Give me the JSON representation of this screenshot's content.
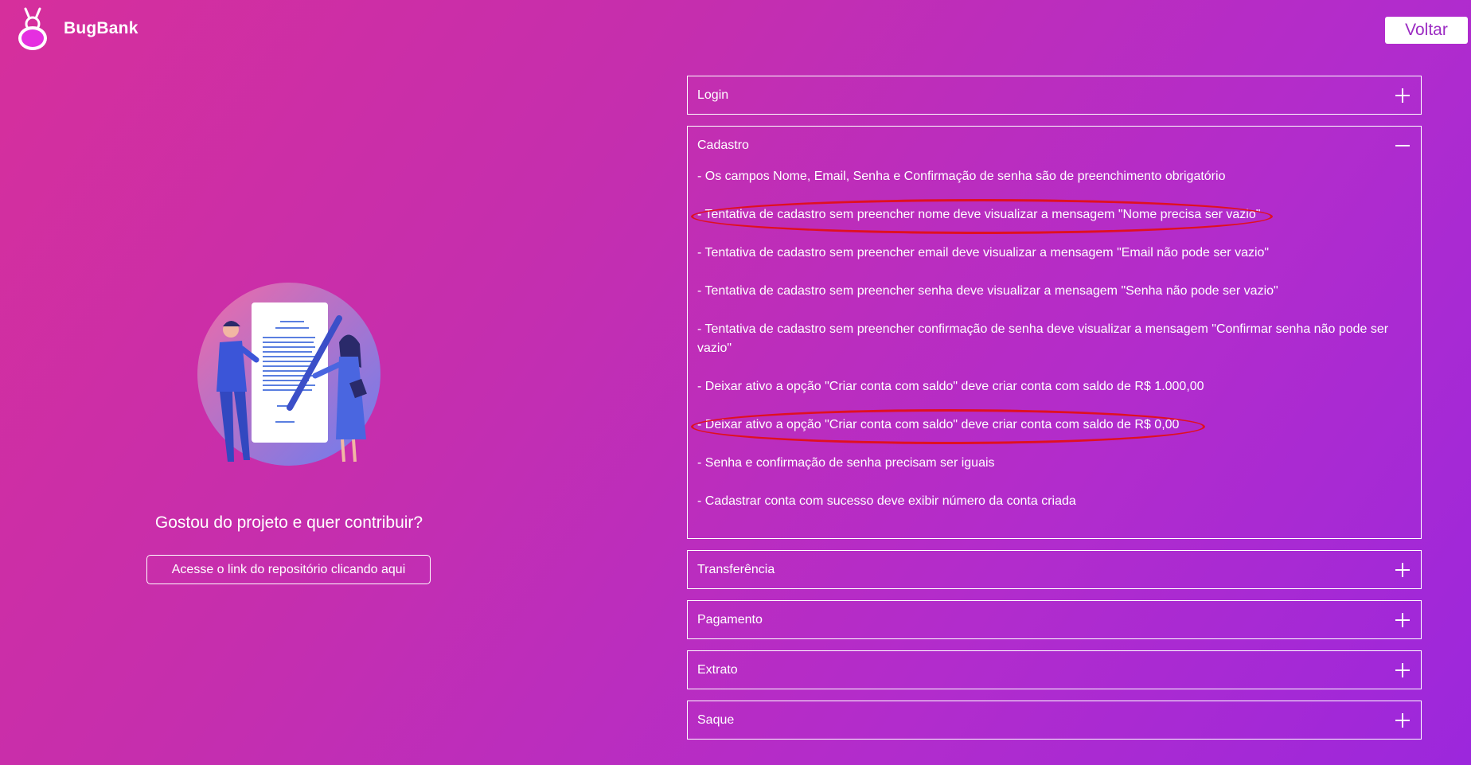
{
  "header": {
    "logo_text": "BugBank",
    "logo_icon": "bug-icon",
    "back_label": "Voltar"
  },
  "left": {
    "illustration": "contract-signing-illustration",
    "contribute_text": "Gostou do projeto e quer contribuir?",
    "repo_button": "Acesse o link do repositório clicando aqui"
  },
  "accordion": {
    "login": {
      "title": "Login",
      "state": "collapsed"
    },
    "cadastro": {
      "title": "Cadastro",
      "state": "expanded",
      "requirements": [
        "- Os campos Nome, Email, Senha e Confirmação de senha são de preenchimento obrigatório",
        "- Tentativa de cadastro sem preencher nome deve visualizar a mensagem \"Nome precisa ser vazio\"",
        "- Tentativa de cadastro sem preencher email deve visualizar a mensagem \"Email não pode ser vazio\"",
        "- Tentativa de cadastro sem preencher senha deve visualizar a mensagem \"Senha não pode ser vazio\"",
        "- Tentativa de cadastro sem preencher confirmação de senha deve visualizar a mensagem \"Confirmar senha não pode ser vazio\"",
        "- Deixar ativo a opção \"Criar conta com saldo\" deve criar conta com saldo de R$ 1.000,00",
        "- Deixar ativo a opção \"Criar conta com saldo\" deve criar conta com saldo de R$ 0,00",
        "- Senha e confirmação de senha precisam ser iguais",
        "- Cadastrar conta com sucesso deve exibir número da conta criada"
      ]
    },
    "transferencia": {
      "title": "Transferência",
      "state": "collapsed"
    },
    "pagamento": {
      "title": "Pagamento",
      "state": "collapsed"
    },
    "extrato": {
      "title": "Extrato",
      "state": "collapsed"
    },
    "saque": {
      "title": "Saque",
      "state": "collapsed"
    }
  },
  "colors": {
    "gradient_start": "#d62f9c",
    "gradient_end": "#9c27dc",
    "highlight": "#e01020",
    "text": "#ffffff"
  }
}
